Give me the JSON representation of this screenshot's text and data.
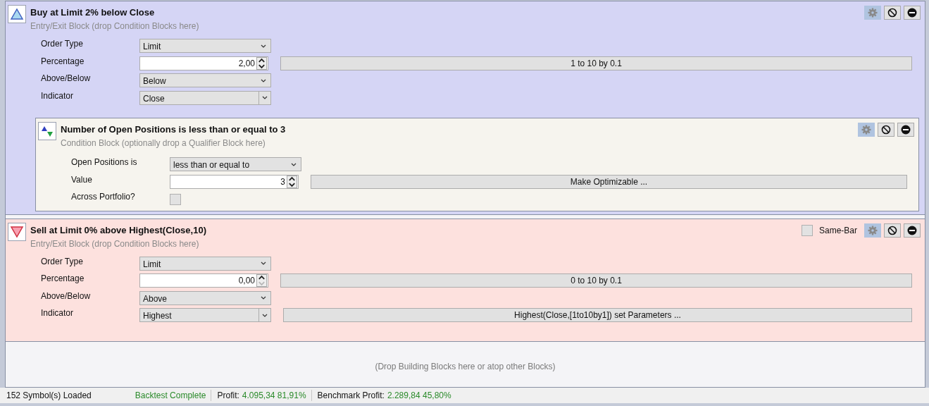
{
  "blocks": [
    {
      "kind": "buy",
      "title": "Buy at Limit 2% below Close",
      "subtitle": "Entry/Exit Block (drop Condition Blocks here)",
      "params": [
        {
          "kind": "dropdown",
          "label": "Order Type",
          "value": "Limit"
        },
        {
          "kind": "spinner",
          "label": "Percentage",
          "value": "2,00",
          "at_minimum": false,
          "range": "1 to 10 by 0.1"
        },
        {
          "kind": "dropdown",
          "label": "Above/Below",
          "value": "Below"
        },
        {
          "kind": "indicator",
          "label": "Indicator",
          "value": "Close"
        }
      ],
      "children": [
        {
          "kind": "condition",
          "title": "Number of Open Positions is less than or equal to 3",
          "subtitle": "Condition Block (optionally drop a Qualifier Block here)",
          "params": [
            {
              "kind": "dropdown",
              "label": "Open Positions is",
              "value": "less than or equal to"
            },
            {
              "kind": "spinner",
              "label": "Value",
              "value": "3",
              "at_minimum": false,
              "range": "Make Optimizable ..."
            },
            {
              "kind": "checkbox",
              "label": "Across Portfolio?",
              "checked": false
            }
          ]
        }
      ]
    },
    {
      "kind": "sell",
      "title": "Sell at Limit 0% above Highest(Close,10)",
      "subtitle": "Entry/Exit Block (drop Condition Blocks here)",
      "same_bar": {
        "label": "Same-Bar",
        "checked": false
      },
      "params": [
        {
          "kind": "dropdown",
          "label": "Order Type",
          "value": "Limit"
        },
        {
          "kind": "spinner",
          "label": "Percentage",
          "value": "0,00",
          "at_minimum": true,
          "range": "0 to 10 by 0.1"
        },
        {
          "kind": "dropdown",
          "label": "Above/Below",
          "value": "Above"
        },
        {
          "kind": "indicator",
          "label": "Indicator",
          "value": "Highest",
          "button": "Highest(Close,[1to10by1]) set Parameters ..."
        }
      ]
    }
  ],
  "drop_hint": "(Drop Building Blocks here or atop other Blocks)",
  "status_bar": {
    "symbols": "152 Symbol(s) Loaded",
    "state": "Backtest Complete",
    "metrics": [
      {
        "label": "Profit:",
        "value": "4.095,34 81,91%"
      },
      {
        "label": "Benchmark Profit:",
        "value": "2.289,84 45,80%"
      }
    ]
  }
}
